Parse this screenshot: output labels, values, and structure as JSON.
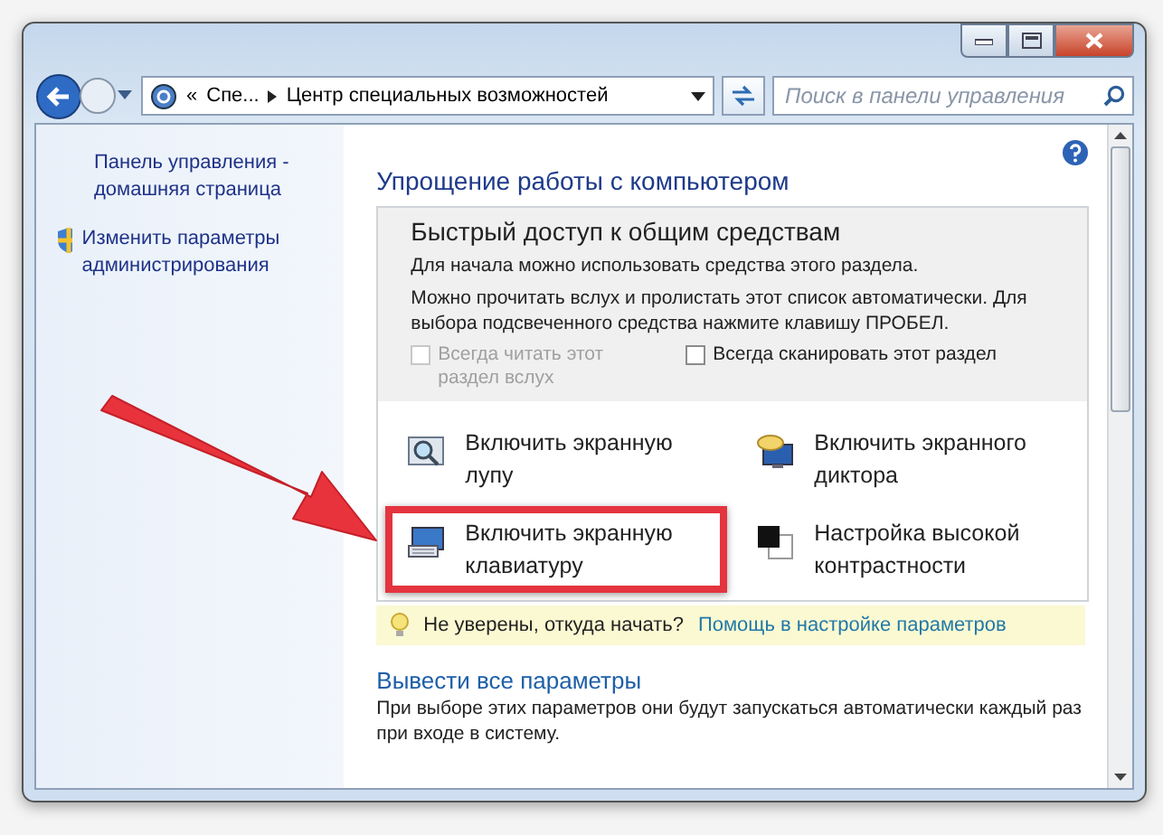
{
  "navigation": {
    "overflow": "«",
    "breadcrumb": [
      "Спе...",
      "Центр специальных возможностей"
    ],
    "search": {
      "placeholder": "Поиск в панели управления"
    }
  },
  "sidebar": {
    "items": [
      {
        "label": "Панель управления - домашняя страница",
        "kind": "link"
      },
      {
        "label": "Изменить параметры администрирования",
        "kind": "shield"
      }
    ]
  },
  "content": {
    "heading": "Упрощение работы с компьютером",
    "quick_access": {
      "title": "Быстрый доступ к общим средствам",
      "intro": "Для начала можно использовать средства этого раздела.",
      "description": "Можно прочитать вслух и пролистать этот список автоматически. Для выбора подсвеченного средства нажмите клавишу ПРОБЕЛ.",
      "options": [
        {
          "label": "Всегда читать этот раздел вслух",
          "checked": false,
          "disabled": true
        },
        {
          "label": "Всегда сканировать этот раздел",
          "checked": false,
          "disabled": false
        }
      ],
      "tools": [
        {
          "label": "Включить экранную лупу",
          "kind": "magnifier",
          "highlighted": false
        },
        {
          "label": "Включить экранного диктора",
          "kind": "narrator",
          "highlighted": false
        },
        {
          "label": "Включить экранную клавиатуру",
          "kind": "keyboard",
          "highlighted": true
        },
        {
          "label": "Настройка высокой контрастности",
          "kind": "contrast",
          "highlighted": false
        }
      ]
    },
    "tip": {
      "question": "Не уверены, откуда начать?",
      "link": "Помощь в настройке параметров"
    },
    "all_settings": {
      "title": "Вывести все параметры",
      "description": "При выборе этих параметров они будут запускаться автоматически каждый раз при входе в систему."
    }
  }
}
